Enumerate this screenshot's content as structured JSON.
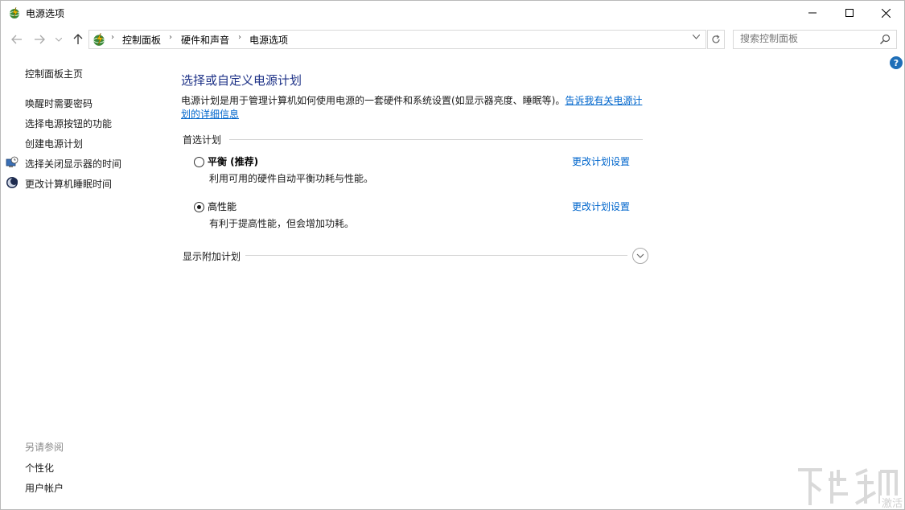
{
  "window": {
    "title": "电源选项",
    "minimize_icon": "minimize-icon",
    "maximize_icon": "maximize-icon",
    "close_icon": "close-icon"
  },
  "addressbar": {
    "back_icon": "arrow-left-icon",
    "forward_icon": "arrow-right-icon",
    "up_icon": "arrow-up-icon",
    "breadcrumbs": [
      "控制面板",
      "硬件和声音",
      "电源选项"
    ],
    "refresh_icon": "refresh-icon",
    "search_placeholder": "搜索控制面板"
  },
  "sidebar": {
    "home": "控制面板主页",
    "items": [
      {
        "label": "唤醒时需要密码",
        "icon": null
      },
      {
        "label": "选择电源按钮的功能",
        "icon": null
      },
      {
        "label": "创建电源计划",
        "icon": null
      },
      {
        "label": "选择关闭显示器的时间",
        "icon": "monitor-clock-icon"
      },
      {
        "label": "更改计算机睡眠时间",
        "icon": "moon-icon"
      }
    ],
    "see_also_heading": "另请参阅",
    "see_also": [
      "个性化",
      "用户帐户"
    ]
  },
  "main": {
    "title": "选择或自定义电源计划",
    "description": "电源计划是用于管理计算机如何使用电源的一套硬件和系统设置(如显示器亮度、睡眠等)。",
    "description_link": "告诉我有关电源计划的详细信息",
    "preferred_heading": "首选计划",
    "plans": [
      {
        "name": "平衡 (推荐)",
        "description": "利用可用的硬件自动平衡功耗与性能。",
        "selected": false,
        "link": "更改计划设置"
      },
      {
        "name": "高性能",
        "description": "有利于提高性能，但会增加功耗。",
        "selected": true,
        "link": "更改计划设置"
      }
    ],
    "additional_heading": "显示附加计划"
  },
  "colors": {
    "title_blue": "#1e3287",
    "link_blue": "#0066cc",
    "help_blue": "#1f6fb8"
  }
}
